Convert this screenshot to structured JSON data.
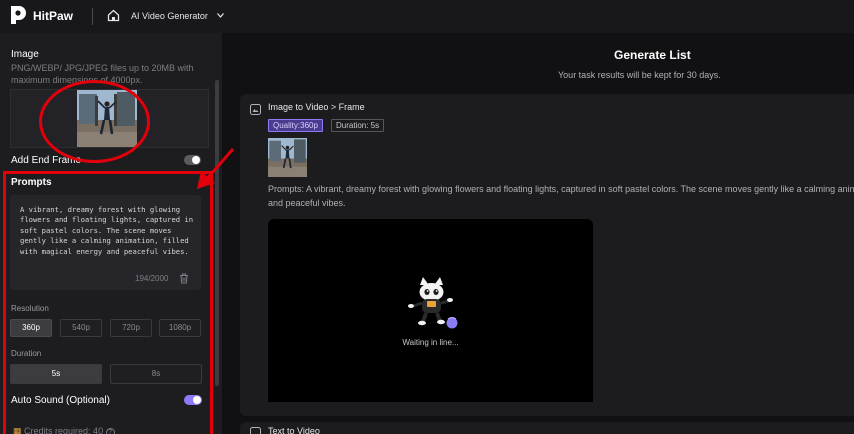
{
  "header": {
    "brand": "HitPaw",
    "product": "AI Video Generator"
  },
  "left_panel": {
    "image_title": "Image",
    "image_desc": "PNG/WEBP/ JPG/JPEG files up to 20MB with maximum dimensions of 4000px.",
    "add_end_frame_label": "Add End Frame",
    "add_end_frame_enabled": false,
    "prompts_title": "Prompts",
    "prompt_text": "A vibrant, dreamy forest with glowing flowers and floating lights, captured in soft pastel colors. The scene moves gently like a calming animation, filled with magical energy and peaceful vibes.",
    "char_count": "194/2000",
    "resolution_label": "Resolution",
    "resolutions": [
      "360p",
      "540p",
      "720p",
      "1080p"
    ],
    "selected_resolution": "360p",
    "duration_label": "Duration",
    "durations": [
      "5s",
      "8s"
    ],
    "selected_duration": "5s",
    "auto_sound_label": "Auto Sound (Optional)",
    "auto_sound_enabled": true,
    "credits": "Credits required: 40"
  },
  "right_panel": {
    "title": "Generate List",
    "subtitle": "Your task results will be kept for 30 days.",
    "task": {
      "title": "Image to Video > Frame",
      "quality_tag": "Quality:360p",
      "duration_tag": "Duration: 5s",
      "prompt_line1": "Prompts:  A vibrant, dreamy forest with glowing flowers and floating lights, captured in soft pastel colors. The scene moves gently like a calming animation, filled with magical energy",
      "prompt_line2": "and peaceful vibes.",
      "status": "Waiting in line..."
    },
    "next_task_title": "Text to Video"
  },
  "colors": {
    "accent": "#8b7cf6",
    "annotation": "#e3000b",
    "background": "#111113",
    "panel": "#1d1d20"
  }
}
